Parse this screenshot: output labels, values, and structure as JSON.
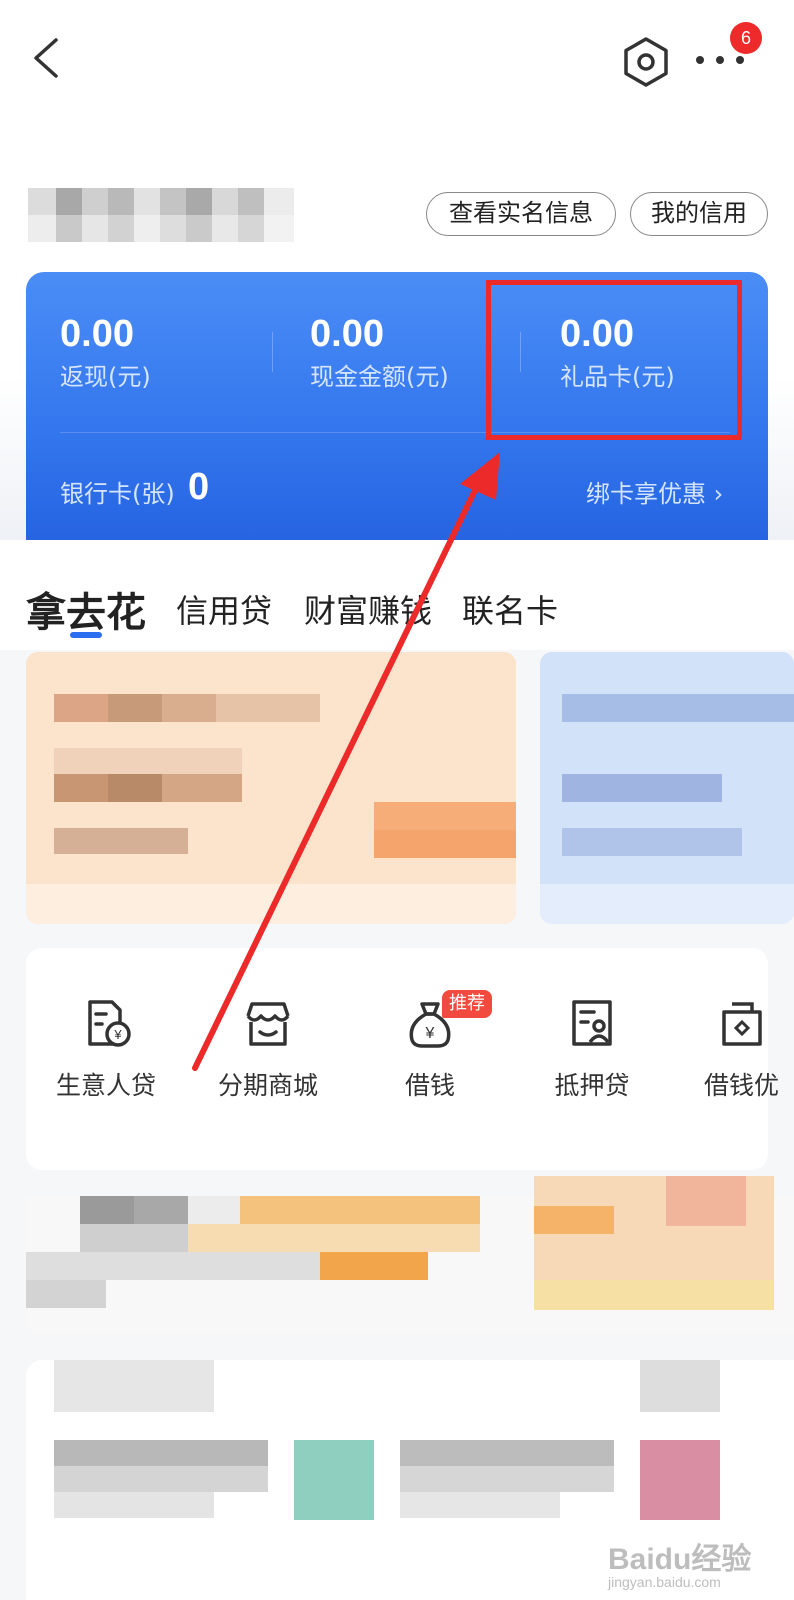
{
  "header": {
    "notification_count": "6",
    "actions": {
      "realname_info": "查看实名信息",
      "my_credit": "我的信用"
    }
  },
  "balance_card": {
    "stats": [
      {
        "value": "0.00",
        "label": "返现(元)"
      },
      {
        "value": "0.00",
        "label": "现金金额(元)"
      },
      {
        "value": "0.00",
        "label": "礼品卡(元)"
      }
    ],
    "bank_card_label": "银行卡(张)",
    "bank_card_count": "0",
    "bind_card_link": "绑卡享优惠 ›"
  },
  "tabs": [
    "拿去花",
    "信用贷",
    "财富赚钱",
    "联名卡"
  ],
  "services": [
    {
      "label": "生意人贷",
      "icon": "business-loan-icon"
    },
    {
      "label": "分期商城",
      "icon": "shop-icon"
    },
    {
      "label": "借钱",
      "icon": "money-bag-icon",
      "badge": "推荐"
    },
    {
      "label": "抵押贷",
      "icon": "mortgage-icon"
    },
    {
      "label": "借钱优",
      "icon": "wallet-icon"
    }
  ],
  "watermark": {
    "logo": "Baidu经验",
    "url": "jingyan.baidu.com"
  },
  "colors": {
    "brand_blue": "#3578ee",
    "highlight_red": "#ec2a2a",
    "badge_red": "#f24a3e"
  }
}
